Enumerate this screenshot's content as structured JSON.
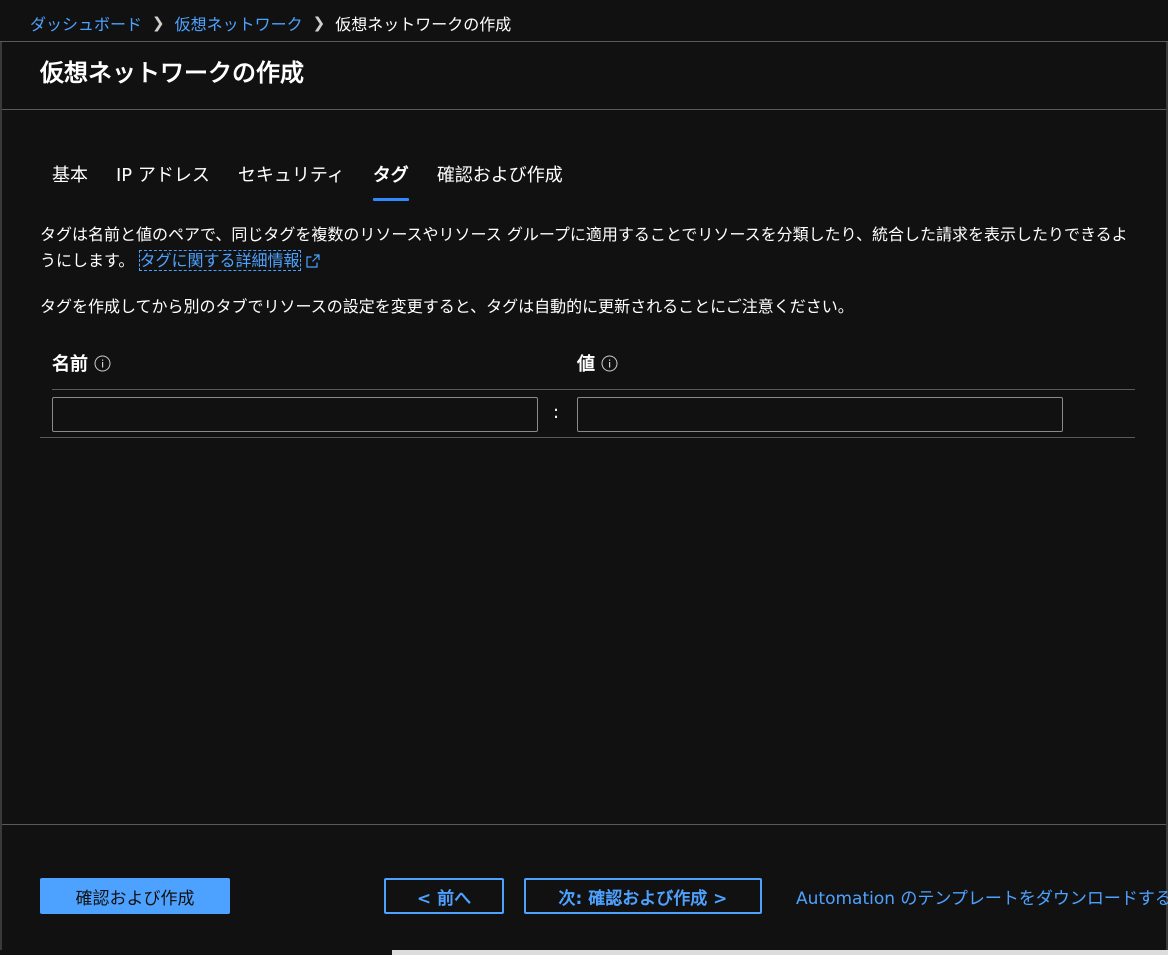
{
  "breadcrumb": {
    "items": [
      "ダッシュボード",
      "仮想ネットワーク",
      "仮想ネットワークの作成"
    ]
  },
  "page": {
    "title": "仮想ネットワークの作成"
  },
  "tabs": [
    {
      "label": "基本",
      "active": false
    },
    {
      "label": "IP アドレス",
      "active": false
    },
    {
      "label": "セキュリティ",
      "active": false
    },
    {
      "label": "タグ",
      "active": true
    },
    {
      "label": "確認および作成",
      "active": false
    }
  ],
  "description": {
    "text": "タグは名前と値のペアで、同じタグを複数のリソースやリソース グループに適用することでリソースを分類したり、統合した請求を表示したりできるようにします。",
    "link": "タグに関する詳細情報"
  },
  "note": "タグを作成してから別のタブでリソースの設定を変更すると、タグは自動的に更新されることにご注意ください。",
  "tag_grid": {
    "name_label": "名前",
    "value_label": "値",
    "separator": ":",
    "rows": [
      {
        "name": "",
        "value": ""
      }
    ]
  },
  "footer": {
    "review_create": "確認および作成",
    "prev": "< 前へ",
    "next": "次: 確認および作成 >",
    "download_template": "Automation のテンプレートをダウンロードする"
  },
  "colors": {
    "background": "#111111",
    "accent": "#4ea2ff",
    "tab_underline": "#2f89ff"
  }
}
